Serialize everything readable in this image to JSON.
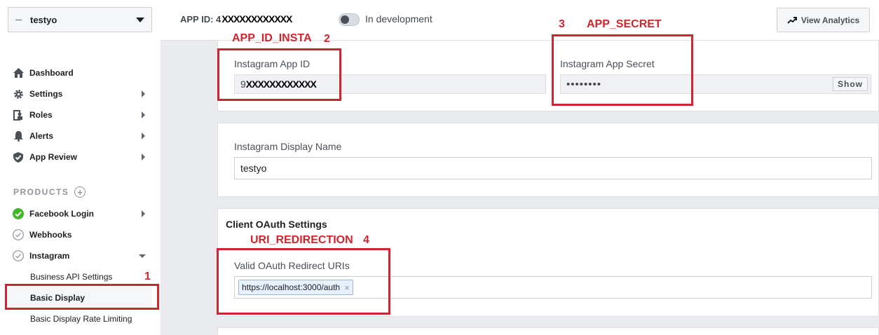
{
  "header": {
    "app_name": "testyo",
    "app_id_label": "APP ID: 4",
    "app_id_masked": "XXXXXXXXXXXX",
    "dev_status": "In development",
    "analytics_button": "View Analytics"
  },
  "sidebar": {
    "items": [
      {
        "label": "Dashboard",
        "icon": "home-icon"
      },
      {
        "label": "Settings",
        "icon": "gear-icon"
      },
      {
        "label": "Roles",
        "icon": "roles-icon"
      },
      {
        "label": "Alerts",
        "icon": "bell-icon"
      },
      {
        "label": "App Review",
        "icon": "shield-check-icon"
      }
    ],
    "products_heading": "PRODUCTS",
    "products": [
      {
        "label": "Facebook Login",
        "icon": "green-check-icon"
      },
      {
        "label": "Webhooks",
        "icon": "check-circle-icon"
      },
      {
        "label": "Instagram",
        "icon": "check-circle-icon"
      }
    ],
    "sub_items": [
      {
        "label": "Business API Settings"
      },
      {
        "label": "Basic Display"
      },
      {
        "label": "Basic Display Rate Limiting"
      }
    ]
  },
  "main": {
    "app_id_field": {
      "label": "Instagram App ID",
      "prefix": "9",
      "masked": "XXXXXXXXXXXX"
    },
    "app_secret_field": {
      "label": "Instagram App Secret",
      "value": "••••••••",
      "show_button": "Show"
    },
    "display_name_field": {
      "label": "Instagram Display Name",
      "value": "testyo"
    },
    "oauth_section": {
      "title": "Client OAuth Settings",
      "redirect_label": "Valid OAuth Redirect URIs",
      "redirect_uri": "https://localhost:3000/auth",
      "remove_glyph": "×"
    }
  },
  "annotations": {
    "a1_number": "1",
    "a2_label": "APP_ID_INSTA",
    "a2_number": "2",
    "a3_number": "3",
    "a3_label": "APP_SECRET",
    "a4_label": "URI_REDIRECTION",
    "a4_number": "4",
    "color": "#d0252e"
  }
}
